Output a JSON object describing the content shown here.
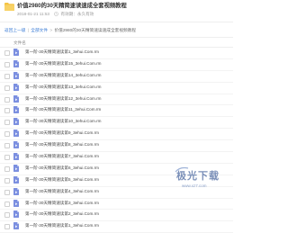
{
  "header": {
    "title": "价值2980的30天精简速读速成全套视频教程",
    "timestamp": "2018-01-21 11:53",
    "expiry": "有效期：永久有效"
  },
  "breadcrumb": {
    "back": "返回上一级",
    "root": "全部文件",
    "current": "价值2980的30天精简速读速成全套视频教程"
  },
  "list": {
    "column_header": "文件名",
    "items": [
      {
        "name": "第一阶-30天精简速读第1_3ehui.Com.rm"
      },
      {
        "name": "第一阶-30天精简速读第15_3ehui.Com.rm"
      },
      {
        "name": "第一阶-30天精简速读第14_3ehui.Com.rm"
      },
      {
        "name": "第一阶-30天精简速读第13_3ehui.Com.rm"
      },
      {
        "name": "第一阶-30天精简速读第12_3ehui.Com.rm"
      },
      {
        "name": "第一阶-30天精简速读第11_3ehui.Com.rm"
      },
      {
        "name": "第一阶-30天精简速读第10_3ehui.Com.rm"
      },
      {
        "name": "第一阶-30天精简速读第9_3ehui.Com.rm"
      },
      {
        "name": "第一阶-30天精简速读第8_3ehui.Com.rm"
      },
      {
        "name": "第一阶-30天精简速读第7_3ehui.Com.rm"
      },
      {
        "name": "第一阶-30天精简速读第6_3ehui.Com.rm"
      },
      {
        "name": "第一阶-30天精简速读第5_3ehui.Com.rm"
      },
      {
        "name": "第一阶-30天精简速读第4_3ehui.Com.rm"
      },
      {
        "name": "第一阶-30天精简速读第3_3ehui.Com.rm"
      },
      {
        "name": "第一阶-30天精简速读第2_3ehui.Com.rm"
      },
      {
        "name": "第一阶-30天精简速读第1_3ehui.Com.rm"
      }
    ]
  },
  "watermark": {
    "logo_text": "极光下载",
    "url": "www.xz7.com"
  },
  "colors": {
    "accent": "#3a7bd5",
    "folder": "#f5c342",
    "file_icon": "#7b8fe0"
  },
  "icons": {
    "folder": "folder-icon",
    "share": "share-icon",
    "file": "video-file-icon"
  }
}
